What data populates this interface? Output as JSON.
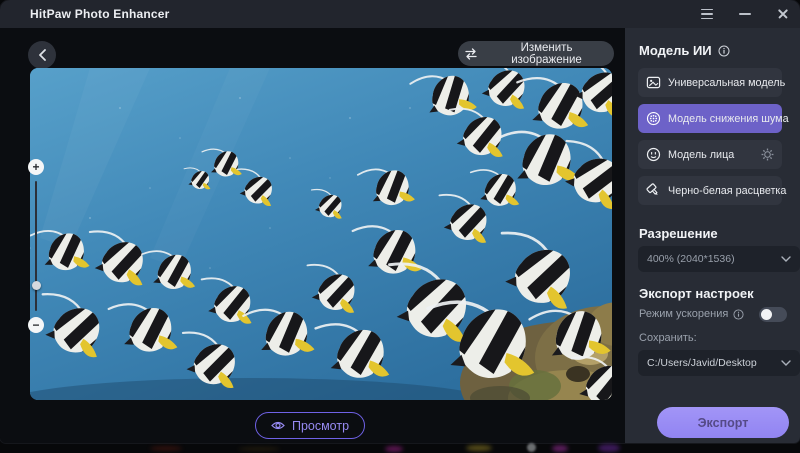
{
  "window": {
    "title": "HitPaw Photo Enhancer"
  },
  "toolbar": {
    "change_image_label": "Изменить изображение"
  },
  "canvas": {
    "image_description": "Underwater photo: dense school of black-white striped longfin bannerfish with yellow fins and long white dorsal streamers swimming in blue water over a tan coral reef in the bottom-right corner",
    "zoom_in": "+",
    "zoom_out": "−"
  },
  "preview": {
    "label": "Просмотр"
  },
  "sidebar": {
    "ai_model": {
      "heading": "Модель ИИ",
      "items": [
        {
          "label": "Универсальная модель",
          "selected": false
        },
        {
          "label": "Модель снижения шума",
          "selected": true
        },
        {
          "label": "Модель лица",
          "selected": false,
          "has_settings": true
        },
        {
          "label": "Черно-белая расцветка",
          "selected": false
        }
      ]
    },
    "resolution": {
      "heading": "Разрешение",
      "value": "400% (2040*1536)"
    },
    "export_settings": {
      "heading": "Экспорт настроек",
      "acceleration_label": "Режим ускорения",
      "acceleration_on": false,
      "save_label": "Сохранить:",
      "save_path": "C:/Users/Javid/Desktop"
    },
    "export_button": "Экспорт"
  },
  "icons": {
    "menu": "hamburger-menu",
    "minimize": "minimize",
    "close": "close",
    "back": "chevron-left",
    "swap": "swap-arrows",
    "info": "info-circle",
    "gear": "settings-gear",
    "chevron_down": "chevron-down",
    "eye": "eye-preview"
  },
  "colors": {
    "accent_selected": "#6d62c8",
    "export_button": "#9a8cf5",
    "preview_outline": "#6f61e6",
    "titlebar": "#22252d",
    "sidebar": "#282c35",
    "canvas_water": "#4089b8"
  }
}
